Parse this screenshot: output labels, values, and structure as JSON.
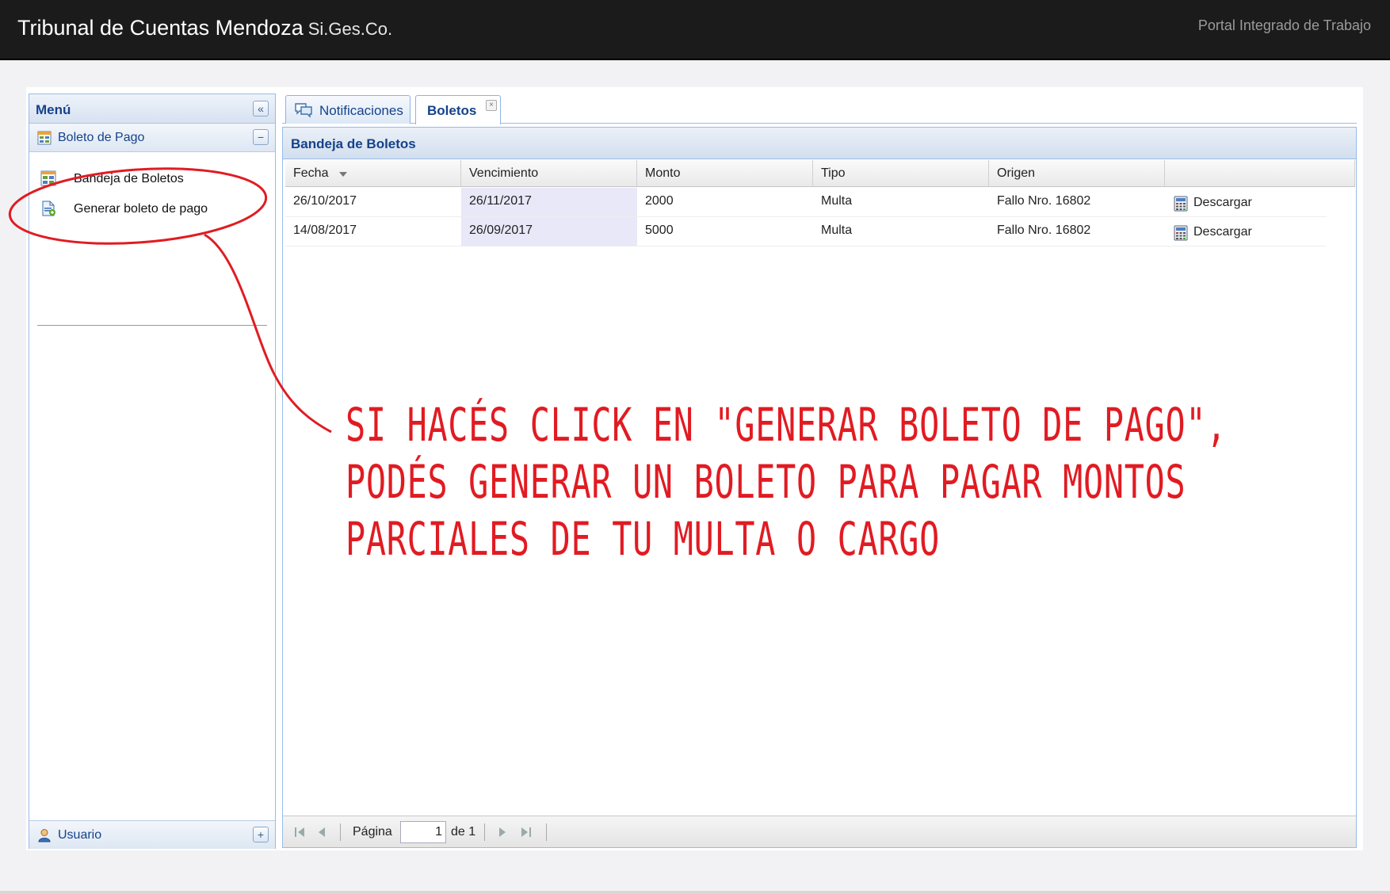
{
  "header": {
    "brand": "Tribunal de Cuentas Mendoza",
    "brand_sub": "Si.Ges.Co.",
    "portal": "Portal Integrado de Trabajo"
  },
  "menu": {
    "title": "Menú",
    "collapse_glyph": "«",
    "section_title": "Boleto de Pago",
    "section_toggle": "−",
    "items": [
      {
        "label": "Bandeja de Boletos",
        "icon": "table-icon"
      },
      {
        "label": "Generar boleto de pago",
        "icon": "new-document-icon"
      }
    ],
    "user_section": "Usuario",
    "user_toggle": "+"
  },
  "tabs": [
    {
      "label": "Notificaciones",
      "icon": "speech-bubble-icon",
      "active": false
    },
    {
      "label": "Boletos",
      "active": true,
      "close": "×"
    }
  ],
  "grid": {
    "title": "Bandeja de Boletos",
    "columns": [
      "Fecha",
      "Vencimiento",
      "Monto",
      "Tipo",
      "Origen",
      ""
    ],
    "rows": [
      {
        "fecha": "26/10/2017",
        "vencimiento": "26/11/2017",
        "monto": "2000",
        "tipo": "Multa",
        "origen": "Fallo Nro. 16802",
        "accion": "Descargar"
      },
      {
        "fecha": "14/08/2017",
        "vencimiento": "26/09/2017",
        "monto": "5000",
        "tipo": "Multa",
        "origen": "Fallo Nro. 16802",
        "accion": "Descargar"
      }
    ]
  },
  "pager": {
    "page_label": "Página",
    "page_value": "1",
    "of_label": "de 1"
  },
  "annotation": {
    "color": "#e11b22",
    "lines": [
      "Si hacés click en \"Generar boleto de pago\",",
      "podés generar un boleto para pagar montos",
      "parciales de tu multa o cargo"
    ]
  }
}
